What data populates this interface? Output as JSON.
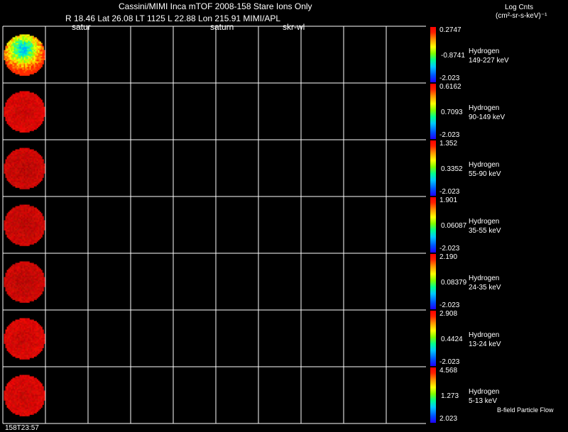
{
  "header": {
    "title_line": "Cassini/MIMI Inca mTOF  2008-158   Stare   Ions Only",
    "info_line": "R        18.46 Lat 26.08 LT 1125 L        22.88 Lon        215.91  MIMI/APL",
    "overlay_satur_1": "satur",
    "overlay_satur_2": "saturn",
    "overlay_skr": "skr-wl",
    "units_line1": "Log Cnts",
    "units_line2": "(cm²-sr-s-keV)⁻¹"
  },
  "footer": {
    "time": "158T23:57",
    "bfield_label": "B-field Particle Flow"
  },
  "chart_data": {
    "type": "heatmap",
    "grid": true,
    "columns": 10,
    "panels": [
      {
        "species": "Hydrogen",
        "energy": "149-227 keV",
        "cmax": "0.2747",
        "cmid": "-0.8741",
        "cmin": "-2.023",
        "pattern": "hot"
      },
      {
        "species": "Hydrogen",
        "energy": "90-149 keV",
        "cmax": "0.6162",
        "cmid": "0.7093",
        "cmin": "-2.023",
        "pattern": "red"
      },
      {
        "species": "Hydrogen",
        "energy": "55-90 keV",
        "cmax": "1.352",
        "cmid": "0.3352",
        "cmin": "-2.023",
        "pattern": "red"
      },
      {
        "species": "Hydrogen",
        "energy": "35-55 keV",
        "cmax": "1.901",
        "cmid": "0.06087",
        "cmin": "-2.023",
        "pattern": "red"
      },
      {
        "species": "Hydrogen",
        "energy": "24-35 keV",
        "cmax": "2.190",
        "cmid": "0.08379",
        "cmin": "-2.023",
        "pattern": "red"
      },
      {
        "species": "Hydrogen",
        "energy": "13-24 keV",
        "cmax": "2.908",
        "cmid": "0.4424",
        "cmin": "-2.023",
        "pattern": "red"
      },
      {
        "species": "Hydrogen",
        "energy": "5-13 keV",
        "cmax": "4.568",
        "cmid": "1.273",
        "cmin": "2.023",
        "pattern": "red"
      }
    ]
  }
}
